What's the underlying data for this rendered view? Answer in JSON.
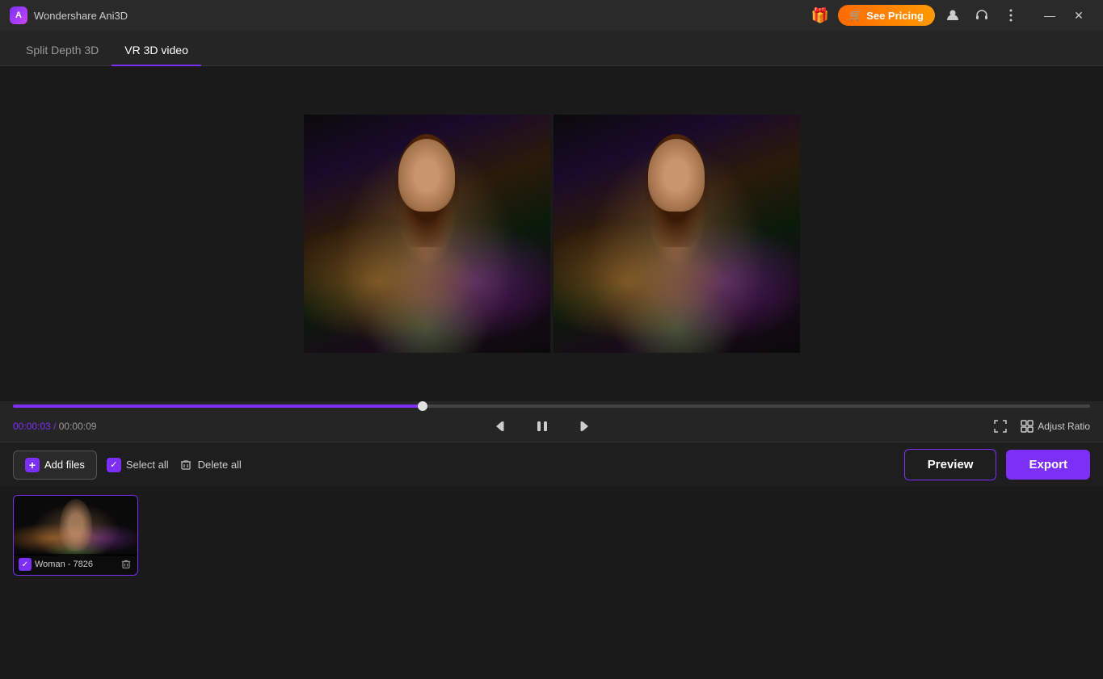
{
  "app": {
    "logo_text": "A",
    "title": "Wondershare Ani3D"
  },
  "titlebar": {
    "gift_icon": "🎁",
    "see_pricing_label": "See Pricing",
    "cart_icon": "🛒",
    "user_icon": "👤",
    "headset_icon": "🎧",
    "menu_icon": "☰",
    "minimize_icon": "—",
    "close_icon": "✕"
  },
  "tabs": [
    {
      "id": "split-depth-3d",
      "label": "Split Depth 3D",
      "active": false
    },
    {
      "id": "vr-3d-video",
      "label": "VR 3D video",
      "active": true
    }
  ],
  "playback": {
    "current_time": "00:00:03",
    "separator": "/",
    "total_time": "00:00:09",
    "seek_percent": 38,
    "skip_back_icon": "⏮",
    "pause_icon": "⏸",
    "skip_forward_icon": "⏭",
    "fullscreen_icon": "⛶",
    "adjust_ratio_icon": "⊞",
    "adjust_ratio_label": "Adjust Ratio"
  },
  "toolbar": {
    "add_files_label": "Add files",
    "select_all_label": "Select all",
    "delete_all_label": "Delete all",
    "preview_label": "Preview",
    "export_label": "Export"
  },
  "files": [
    {
      "id": "woman-7826",
      "name": "Woman - 7826",
      "checked": true
    }
  ],
  "colors": {
    "accent_purple": "#7b2ff7",
    "accent_orange": "#ff6a00",
    "bg_dark": "#1a1a1a",
    "bg_medium": "#252525",
    "text_primary": "#ffffff",
    "text_secondary": "#999999",
    "current_time_color": "#7b2ff7"
  }
}
